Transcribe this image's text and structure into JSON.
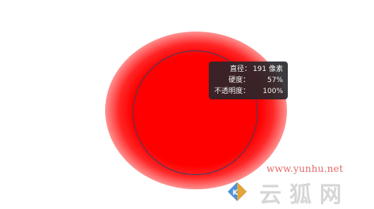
{
  "hud": {
    "diameter_label": "直径：",
    "diameter_value": "191",
    "diameter_unit": "像素",
    "hardness_label": "硬度：",
    "hardness_value": "57%",
    "opacity_label": "不透明度：",
    "opacity_value": "100%"
  },
  "brush": {
    "color": "#ff0000",
    "outline_color": "#3a3f63"
  },
  "watermark": {
    "url": "www.yunhu.net",
    "brand_text": "云狐网",
    "url_color": "#e16a6a"
  },
  "icons": {
    "watermark_logo": "km-logo-icon"
  }
}
